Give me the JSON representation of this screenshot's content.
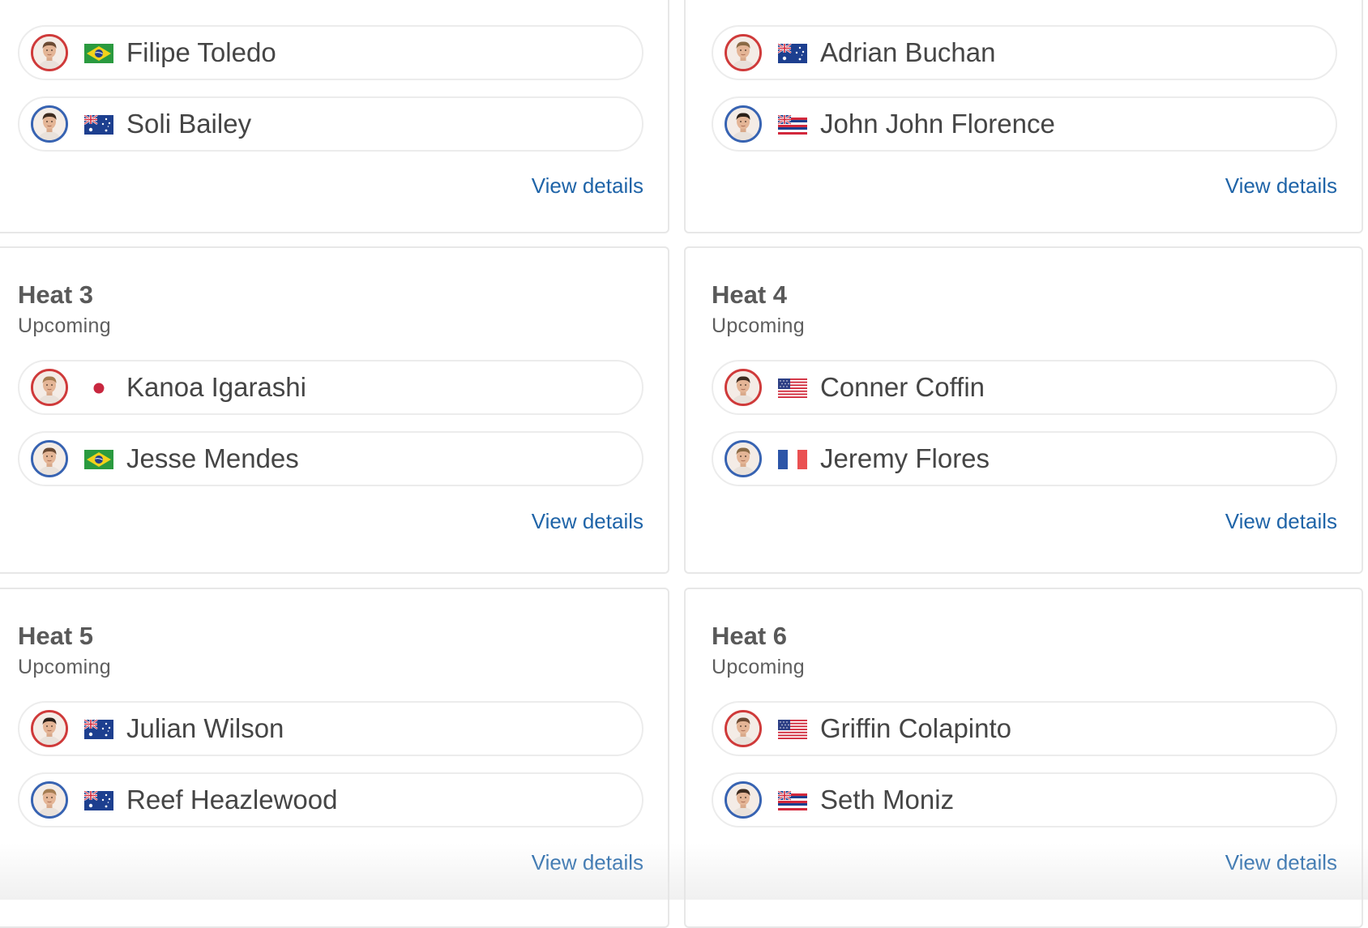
{
  "view_details_label": "View details",
  "colors": {
    "link": "#1f64a8",
    "avatar_ring_red": "#cf3a3a",
    "avatar_ring_blue": "#3763b2"
  },
  "heats": [
    {
      "athletes": [
        {
          "name": "Filipe Toledo",
          "flag": "brazil-flag",
          "ring": "red"
        },
        {
          "name": "Soli Bailey",
          "flag": "australia-flag",
          "ring": "blue"
        }
      ]
    },
    {
      "athletes": [
        {
          "name": "Adrian Buchan",
          "flag": "australia-flag",
          "ring": "red"
        },
        {
          "name": "John John Florence",
          "flag": "hawaii-flag",
          "ring": "blue"
        }
      ]
    },
    {
      "title": "Heat 3",
      "status": "Upcoming",
      "athletes": [
        {
          "name": "Kanoa Igarashi",
          "flag": "japan-flag",
          "ring": "red"
        },
        {
          "name": "Jesse Mendes",
          "flag": "brazil-flag",
          "ring": "blue"
        }
      ]
    },
    {
      "title": "Heat 4",
      "status": "Upcoming",
      "athletes": [
        {
          "name": "Conner Coffin",
          "flag": "usa-flag",
          "ring": "red"
        },
        {
          "name": "Jeremy Flores",
          "flag": "france-flag",
          "ring": "blue"
        }
      ]
    },
    {
      "title": "Heat 5",
      "status": "Upcoming",
      "athletes": [
        {
          "name": "Julian Wilson",
          "flag": "australia-flag",
          "ring": "red"
        },
        {
          "name": "Reef Heazlewood",
          "flag": "australia-flag",
          "ring": "blue"
        }
      ]
    },
    {
      "title": "Heat 6",
      "status": "Upcoming",
      "athletes": [
        {
          "name": "Griffin Colapinto",
          "flag": "usa-flag",
          "ring": "red"
        },
        {
          "name": "Seth Moniz",
          "flag": "hawaii-flag",
          "ring": "blue"
        }
      ]
    }
  ]
}
